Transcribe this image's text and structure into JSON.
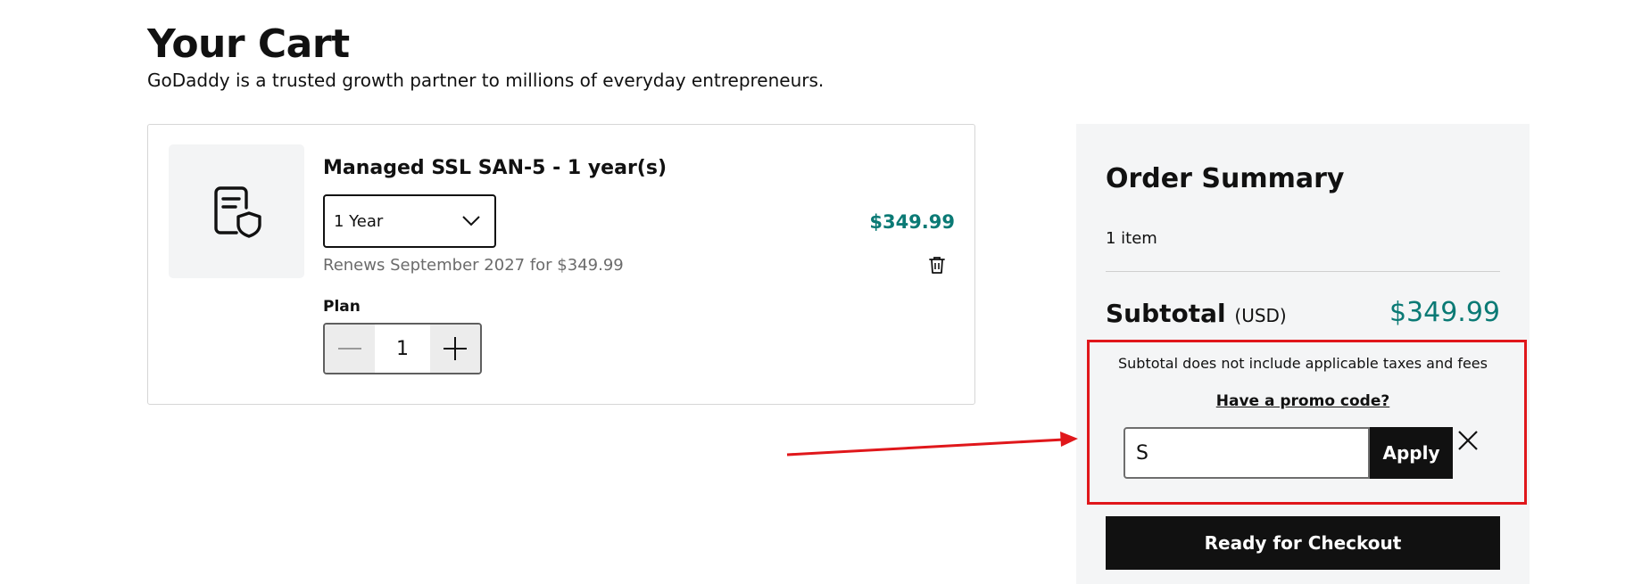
{
  "header": {
    "title": "Your Cart",
    "subtitle": "GoDaddy is a trusted growth partner to millions of everyday entrepreneurs."
  },
  "cart_item": {
    "icon": "ssl-certificate-icon",
    "name": "Managed SSL SAN-5 - 1 year(s)",
    "term_selected": "1 Year",
    "price": "$349.99",
    "renewal_text": "Renews September 2027 for $349.99",
    "plan_label": "Plan",
    "quantity": "1"
  },
  "summary": {
    "title": "Order Summary",
    "item_count": "1 item",
    "subtotal_label": "Subtotal",
    "subtotal_currency": "(USD)",
    "subtotal_value": "$349.99",
    "tax_note": "Subtotal does not include applicable taxes and fees",
    "promo_link": "Have a promo code?",
    "promo_input_value": "S",
    "apply_label": "Apply",
    "checkout_label": "Ready for Checkout"
  },
  "colors": {
    "accent_price": "#0b7a75",
    "annotation_red": "#e0171b",
    "button_dark": "#111111"
  }
}
